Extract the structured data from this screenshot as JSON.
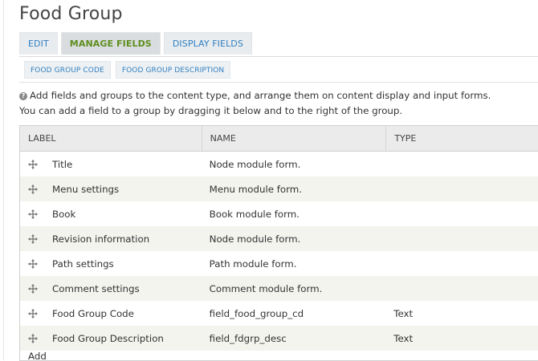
{
  "page": {
    "title": "Food Group"
  },
  "primary_tabs": [
    {
      "label": "EDIT",
      "active": false
    },
    {
      "label": "MANAGE FIELDS",
      "active": true
    },
    {
      "label": "DISPLAY FIELDS",
      "active": false
    }
  ],
  "secondary_tabs": [
    {
      "label": "FOOD GROUP CODE"
    },
    {
      "label": "FOOD GROUP DESCRIPTION"
    }
  ],
  "help": {
    "line1": "Add fields and groups to the content type, and arrange them on content display and input forms.",
    "line2": "You can add a field to a group by dragging it below and to the right of the group."
  },
  "table": {
    "headers": {
      "label": "LABEL",
      "name": "NAME",
      "type": "TYPE"
    },
    "rows": [
      {
        "label": "Title",
        "name": "Node module form.",
        "type": ""
      },
      {
        "label": "Menu settings",
        "name": "Menu module form.",
        "type": ""
      },
      {
        "label": "Book",
        "name": "Book module form.",
        "type": ""
      },
      {
        "label": "Revision information",
        "name": "Node module form.",
        "type": ""
      },
      {
        "label": "Path settings",
        "name": "Path module form.",
        "type": ""
      },
      {
        "label": "Comment settings",
        "name": "Comment module form.",
        "type": ""
      },
      {
        "label": "Food Group Code",
        "name": "field_food_group_cd",
        "type": "Text"
      },
      {
        "label": "Food Group Description",
        "name": "field_fdgrp_desc",
        "type": "Text"
      }
    ],
    "add_label": "Add"
  },
  "colors": {
    "tab_link": "#2f7fc2",
    "tab_active": "#5e8d1e",
    "row_stripe": "#f3f4ee",
    "header_bg": "#ebebeb"
  }
}
